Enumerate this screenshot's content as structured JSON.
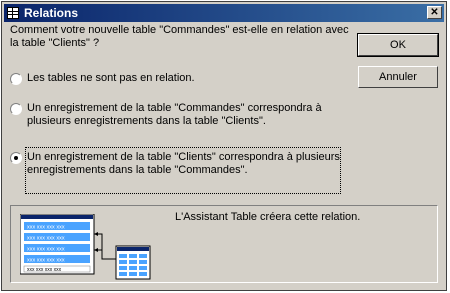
{
  "window": {
    "title": "Relations",
    "close_glyph": "✕"
  },
  "question": "Comment votre nouvelle table \"Commandes\" est-elle en relation avec la table \"Clients\" ?",
  "buttons": {
    "ok": "OK",
    "cancel": "Annuler"
  },
  "options": [
    {
      "label": "Les tables ne sont pas en relation.",
      "selected": false
    },
    {
      "label": "Un enregistrement de la table \"Commandes\" correspondra à plusieurs enregistrements dans la table \"Clients\".",
      "selected": false
    },
    {
      "label": "Un enregistrement de la table \"Clients\" correspondra à plusieurs enregistrements dans la table \"Commandes\".",
      "selected": true
    }
  ],
  "info": {
    "text": "L'Assistant Table créera cette relation.",
    "row_text": "xxx xxx xxx xxx"
  },
  "colors": {
    "title_start": "#0a246a",
    "title_end": "#3a6ea5",
    "face": "#d4d0c8",
    "table_header": "#0a246a",
    "table_cell": "#4aa3ff"
  }
}
